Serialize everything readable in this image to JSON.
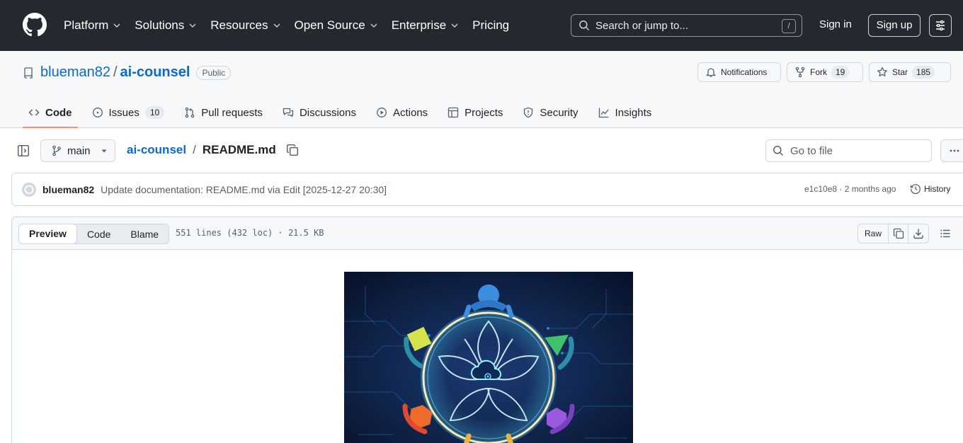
{
  "header": {
    "nav": [
      {
        "label": "Platform"
      },
      {
        "label": "Solutions"
      },
      {
        "label": "Resources"
      },
      {
        "label": "Open Source"
      },
      {
        "label": "Enterprise"
      },
      {
        "label": "Pricing"
      }
    ],
    "search_placeholder": "Search or jump to...",
    "search_shortcut": "/",
    "sign_in": "Sign in",
    "sign_up": "Sign up"
  },
  "repo": {
    "owner": "blueman82",
    "separator": "/",
    "name": "ai-counsel",
    "visibility": "Public",
    "notifications_label": "Notifications",
    "fork_label": "Fork",
    "fork_count": "19",
    "star_label": "Star",
    "star_count": "185"
  },
  "tabs": [
    {
      "label": "Code",
      "icon": "code-icon",
      "active": true
    },
    {
      "label": "Issues",
      "icon": "issue-icon",
      "count": "10"
    },
    {
      "label": "Pull requests",
      "icon": "pull-request-icon"
    },
    {
      "label": "Discussions",
      "icon": "discussions-icon"
    },
    {
      "label": "Actions",
      "icon": "play-icon"
    },
    {
      "label": "Projects",
      "icon": "table-icon"
    },
    {
      "label": "Security",
      "icon": "shield-icon"
    },
    {
      "label": "Insights",
      "icon": "graph-icon"
    }
  ],
  "filebar": {
    "branch": "main",
    "crumb_repo": "ai-counsel",
    "crumb_sep": "/",
    "file_name": "README.md",
    "goto_placeholder": "Go to file"
  },
  "commit": {
    "author": "blueman82",
    "message": "Update documentation: README.md via Edit [2025-12-27 20:30]",
    "meta": "e1c10e8 · 2 months ago",
    "history_label": "History"
  },
  "viewer": {
    "modes": [
      "Preview",
      "Code",
      "Blame"
    ],
    "active_mode": "Preview",
    "info": "551 lines (432 loc) · 21.5 KB",
    "raw_label": "Raw"
  },
  "colors": {
    "header_bg": "#24292f",
    "link": "#0969da",
    "active_tab_underline": "#fd8c73",
    "hero_bg": "#0d1b3a",
    "hero_ring": "#ffe9b3"
  }
}
